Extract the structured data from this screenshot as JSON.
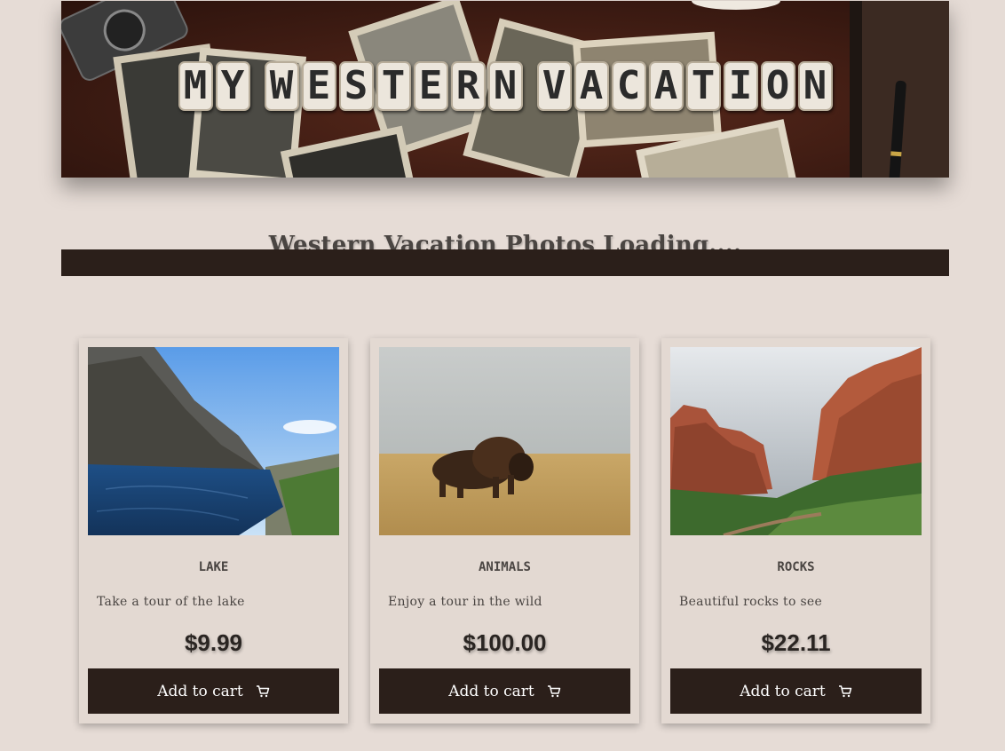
{
  "banner": {
    "title_letters": [
      "M",
      "Y",
      " ",
      "W",
      "E",
      "S",
      "T",
      "E",
      "R",
      "N",
      " ",
      "V",
      "A",
      "C",
      "A",
      "T",
      "I",
      "O",
      "N"
    ],
    "title_text": "MY WESTERN VACATION"
  },
  "loading": {
    "title": "Western Vacation Photos Loading....",
    "progress": 1.0
  },
  "products": [
    {
      "name": "LAKE",
      "description": "Take a tour of the lake",
      "price": "$9.99",
      "button_label": "Add to cart"
    },
    {
      "name": "ANIMALS",
      "description": "Enjoy a tour in the wild",
      "price": "$100.00",
      "button_label": "Add to cart"
    },
    {
      "name": "ROCKS",
      "description": "Beautiful rocks to see",
      "price": "$22.11",
      "button_label": "Add to cart"
    }
  ],
  "icons": {
    "cart": "shopping-cart-icon"
  },
  "colors": {
    "page_background": "#e6dcd6",
    "dark_accent": "#2b1f1a",
    "card_background": "#e3d9d2",
    "text": "#4a4542"
  }
}
